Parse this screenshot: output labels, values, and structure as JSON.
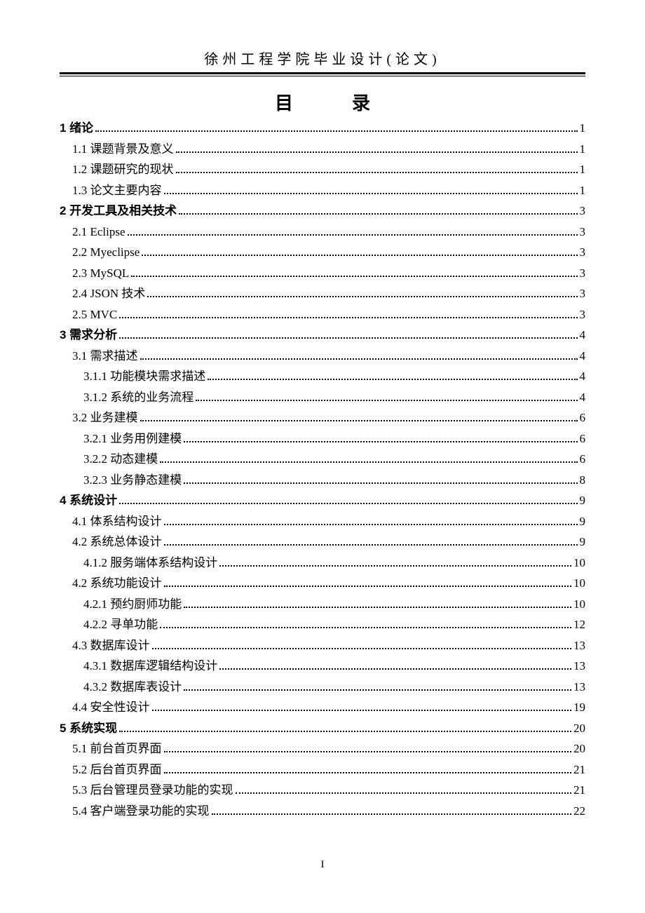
{
  "header": "徐州工程学院毕业设计(论文)",
  "toc_title_left": "目",
  "toc_title_right": "录",
  "footer": "I",
  "entries": [
    {
      "label": "1 绪论",
      "page": "1",
      "level": 0,
      "bold": true
    },
    {
      "label": "1.1 课题背景及意义",
      "page": "1",
      "level": 1,
      "bold": false
    },
    {
      "label": "1.2 课题研究的现状",
      "page": "1",
      "level": 1,
      "bold": false
    },
    {
      "label": "1.3 论文主要内容",
      "page": "1",
      "level": 1,
      "bold": false
    },
    {
      "label": "2 开发工具及相关技术",
      "page": "3",
      "level": 0,
      "bold": true
    },
    {
      "label": "2.1 Eclipse",
      "page": "3",
      "level": 1,
      "bold": false
    },
    {
      "label": "2.2 Myeclipse",
      "page": "3",
      "level": 1,
      "bold": false
    },
    {
      "label": "2.3 MySQL",
      "page": "3",
      "level": 1,
      "bold": false
    },
    {
      "label": "2.4 JSON 技术",
      "page": "3",
      "level": 1,
      "bold": false
    },
    {
      "label": "2.5 MVC",
      "page": "3",
      "level": 1,
      "bold": false
    },
    {
      "label": "3 需求分析",
      "page": "4",
      "level": 0,
      "bold": true
    },
    {
      "label": "3.1 需求描述",
      "page": "4",
      "level": 1,
      "bold": false
    },
    {
      "label": "3.1.1 功能模块需求描述",
      "page": "4",
      "level": 2,
      "bold": false
    },
    {
      "label": "3.1.2 系统的业务流程",
      "page": "4",
      "level": 2,
      "bold": false
    },
    {
      "label": "3.2 业务建模",
      "page": "6",
      "level": 1,
      "bold": false
    },
    {
      "label": "3.2.1 业务用例建模",
      "page": "6",
      "level": 2,
      "bold": false
    },
    {
      "label": "3.2.2 动态建模",
      "page": "6",
      "level": 2,
      "bold": false
    },
    {
      "label": "3.2.3 业务静态建模",
      "page": "8",
      "level": 2,
      "bold": false
    },
    {
      "label": "4 系统设计",
      "page": "9",
      "level": 0,
      "bold": true
    },
    {
      "label": "4.1 体系结构设计",
      "page": "9",
      "level": 1,
      "bold": false
    },
    {
      "label": "4.2 系统总体设计",
      "page": "9",
      "level": 1,
      "bold": false
    },
    {
      "label": "4.1.2 服务端体系结构设计",
      "page": "10",
      "level": 2,
      "bold": false
    },
    {
      "label": "4.2 系统功能设计",
      "page": "10",
      "level": 1,
      "bold": false
    },
    {
      "label": "4.2.1 预约厨师功能",
      "page": "10",
      "level": 2,
      "bold": false
    },
    {
      "label": "4.2.2 寻单功能",
      "page": "12",
      "level": 2,
      "bold": false
    },
    {
      "label": "4.3 数据库设计",
      "page": "13",
      "level": 1,
      "bold": false
    },
    {
      "label": "4.3.1 数据库逻辑结构设计",
      "page": "13",
      "level": 2,
      "bold": false
    },
    {
      "label": "4.3.2 数据库表设计",
      "page": "13",
      "level": 2,
      "bold": false
    },
    {
      "label": "4.4 安全性设计",
      "page": "19",
      "level": 1,
      "bold": false
    },
    {
      "label": "5 系统实现",
      "page": "20",
      "level": 0,
      "bold": true
    },
    {
      "label": "5.1 前台首页界面",
      "page": "20",
      "level": 1,
      "bold": false
    },
    {
      "label": "5.2 后台首页界面",
      "page": "21",
      "level": 1,
      "bold": false
    },
    {
      "label": "5.3 后台管理员登录功能的实现",
      "page": "21",
      "level": 1,
      "bold": false
    },
    {
      "label": "5.4 客户端登录功能的实现",
      "page": "22",
      "level": 1,
      "bold": false
    }
  ]
}
